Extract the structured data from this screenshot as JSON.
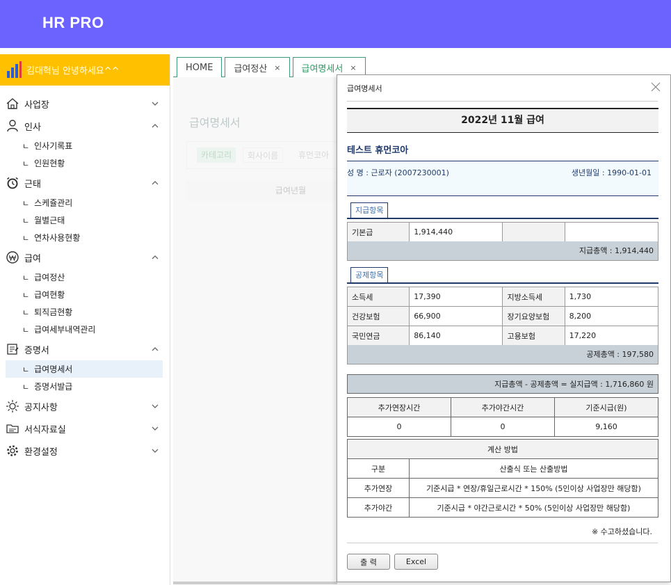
{
  "app": {
    "brand": "HR PRO"
  },
  "sidebar": {
    "greeting": "김대혁님 안녕하세요^^",
    "groups": [
      {
        "label": "사업장",
        "icon": "home-icon",
        "expanded": false,
        "items": []
      },
      {
        "label": "인사",
        "icon": "person-icon",
        "expanded": true,
        "items": [
          "인사기록표",
          "인원현황"
        ]
      },
      {
        "label": "근태",
        "icon": "alarm-clock-icon",
        "expanded": true,
        "items": [
          "스케쥴관리",
          "월별근태",
          "연차사용현황"
        ]
      },
      {
        "label": "급여",
        "icon": "won-coin-icon",
        "expanded": true,
        "items": [
          "급여정산",
          "급여현황",
          "퇴직금현황",
          "급여세부내역관리"
        ]
      },
      {
        "label": "증명서",
        "icon": "certificate-icon",
        "expanded": true,
        "items": [
          "급여명세서",
          "증명서발급"
        ]
      },
      {
        "label": "공지사항",
        "icon": "sun-bulb-icon",
        "expanded": false,
        "items": []
      },
      {
        "label": "서식자료실",
        "icon": "folder-icon",
        "expanded": false,
        "items": []
      },
      {
        "label": "환경설정",
        "icon": "gear-icon",
        "expanded": false,
        "items": []
      }
    ],
    "active_item": "급여명세서",
    "sub_prefix": "ㄴ"
  },
  "tabs": [
    {
      "label": "HOME",
      "closable": false
    },
    {
      "label": "급여정산",
      "closable": true
    },
    {
      "label": "급여명세서",
      "closable": true,
      "active": true
    }
  ],
  "background_page": {
    "title": "급여명세서",
    "filter_chips": [
      "카테고리",
      "회사이름",
      "휴먼코아"
    ],
    "table_header": "급여년월"
  },
  "modal": {
    "title": "급여명세서",
    "pay_heading": "2022년 11월 급여",
    "company": "테스트 휴먼코아",
    "employee_info": "성 명 : 근로자 (2007230001)",
    "birth_info": "생년월일 : 1990-01-01",
    "pay_section": {
      "label": "지급항목",
      "rows": [
        [
          "기본급",
          "1,914,440",
          "",
          ""
        ]
      ],
      "total": "지급총액 : 1,914,440"
    },
    "deduction_section": {
      "label": "공제항목",
      "rows": [
        [
          "소득세",
          "17,390",
          "지방소득세",
          "1,730"
        ],
        [
          "건강보험",
          "66,900",
          "장기요양보험",
          "8,200"
        ],
        [
          "국민연금",
          "86,140",
          "고용보험",
          "17,220"
        ]
      ],
      "total": "공제총액 : 197,580"
    },
    "net_pay": "지급총액 - 공제총액 = 실지급액 : 1,716,860 원",
    "hours_table": {
      "headers": [
        "추가연장시간",
        "추가야간시간",
        "기준시급(원)"
      ],
      "values": [
        "0",
        "0",
        "9,160"
      ]
    },
    "calc_table": {
      "title": "계산 방법",
      "headers": [
        "구분",
        "산출식 또는 산출방법"
      ],
      "rows": [
        [
          "추가연장",
          "기준시급 * 연장/휴일근로시간 * 150% (5인이상 사업장만 해당함)"
        ],
        [
          "추가야간",
          "기준시급 * 야간근로시간 * 50% (5인이상 사업장만 해당함)"
        ]
      ]
    },
    "thanks": "※ 수고하셨습니다.",
    "print_button": "출 력",
    "excel_button": "Excel"
  },
  "colors": {
    "header": "#6c63ff",
    "greeting": "#ffc000",
    "tab_border": "#3b9c7a",
    "navy": "#1f3a6a",
    "sum_bar": "#c8d1d8"
  }
}
